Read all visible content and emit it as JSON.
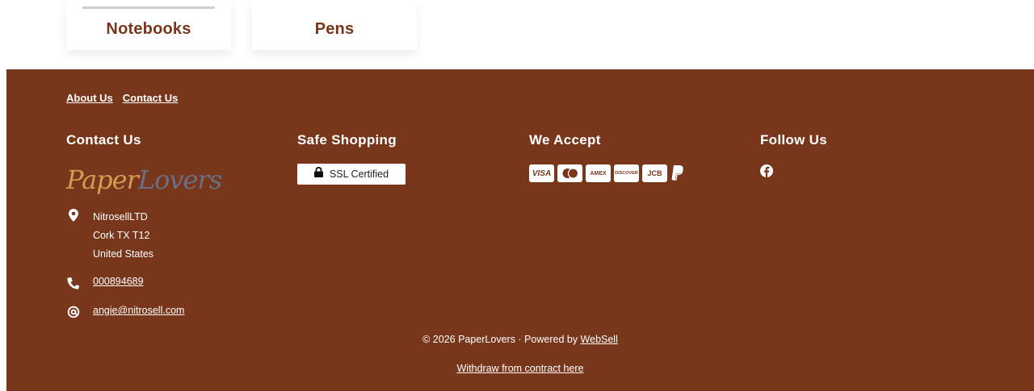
{
  "categories": [
    {
      "label": "Notebooks"
    },
    {
      "label": "Pens"
    }
  ],
  "footer": {
    "top_links": {
      "about": "About Us",
      "contact": "Contact Us"
    },
    "contact": {
      "heading": "Contact Us",
      "logo": {
        "part1": "Paper",
        "part2": "Lovers"
      },
      "address": [
        "NitrosellLTD",
        "Cork TX T12",
        "United States"
      ],
      "phone": "000894689",
      "email": "angie@nitrosell.com"
    },
    "safe": {
      "heading": "Safe Shopping",
      "ssl_label": "SSL Certified"
    },
    "accept": {
      "heading": "We Accept",
      "methods": [
        "VISA",
        "MC",
        "AMEX",
        "DISCOVER",
        "JCB",
        "P"
      ]
    },
    "follow": {
      "heading": "Follow Us",
      "icon": "facebook-icon"
    },
    "copyright_text": "© 2026 PaperLovers · Powered by ",
    "powered_link": "WebSell",
    "withdraw_link": "Withdraw from contract here"
  },
  "colors": {
    "footer_bg": "#78361b",
    "accent_text": "#78361b",
    "logo_gold": "#d69a52",
    "logo_grey": "#6b6f86"
  }
}
